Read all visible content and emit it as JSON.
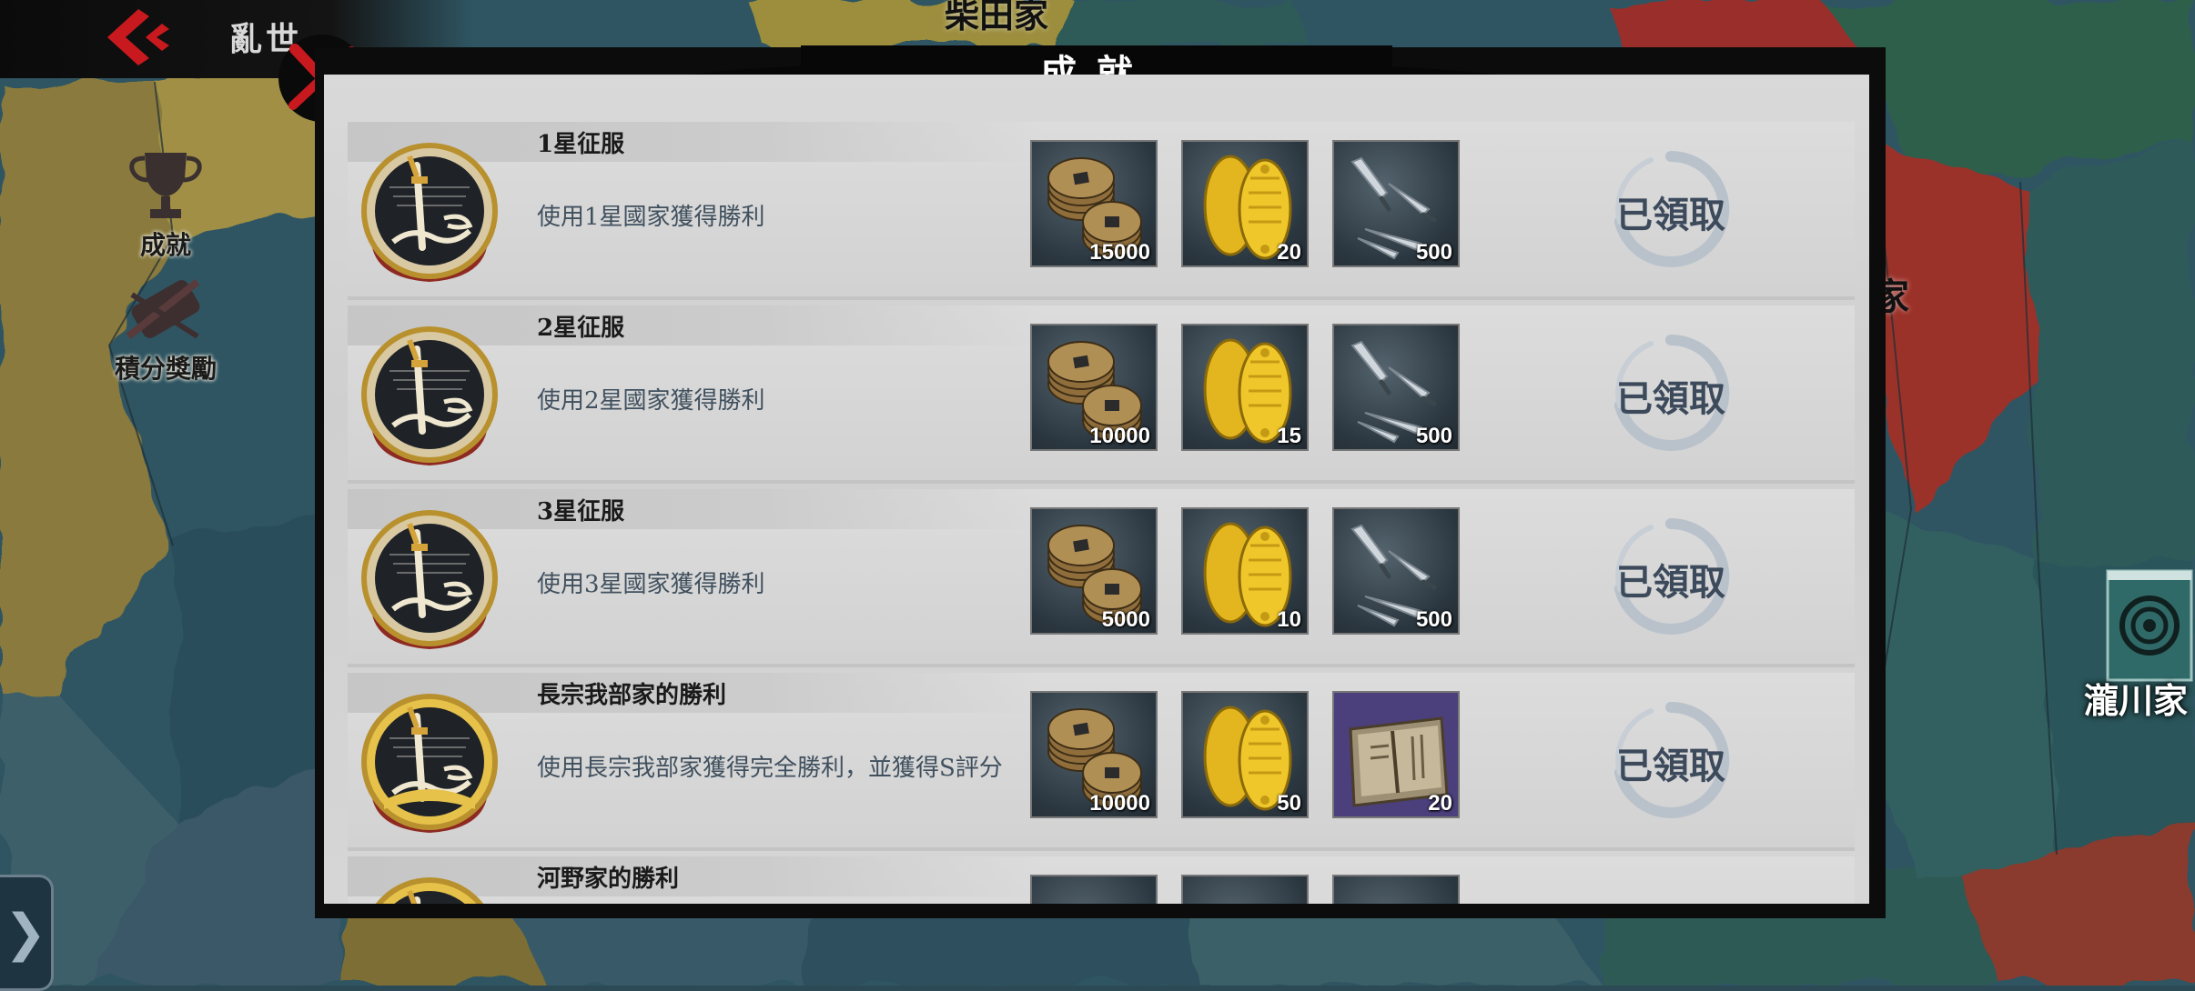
{
  "header": {
    "mode_title": "亂世",
    "panel_title": "成就"
  },
  "side_menu": {
    "achievements_label": "成就",
    "points_reward_label": "積分獎勵"
  },
  "map_labels": {
    "top": "柴田家",
    "right": "家",
    "bottom_right": "瀧川家"
  },
  "icons": {
    "back": "back-arrow-icon",
    "close": "close-x-icon",
    "trophy": "trophy-icon",
    "scroll": "scroll-sword-icon",
    "expand": "chevron-right-icon",
    "coin": "coin-stack-icon",
    "gold": "koban-gold-icon",
    "kunai": "kunai-icon",
    "book": "book-icon"
  },
  "colors": {
    "accent_red": "#c8191e",
    "panel_bg": "#d4d4d4",
    "claimed_text": "#3c4a5c"
  },
  "achievements": [
    {
      "name": "1星征服",
      "description": "使用1星國家獲得勝利",
      "rewards": [
        {
          "item": "coins",
          "qty": "15000"
        },
        {
          "item": "gold",
          "qty": "20"
        },
        {
          "item": "kunai",
          "qty": "500"
        }
      ],
      "status": "已領取"
    },
    {
      "name": "2星征服",
      "description": "使用2星國家獲得勝利",
      "rewards": [
        {
          "item": "coins",
          "qty": "10000"
        },
        {
          "item": "gold",
          "qty": "15"
        },
        {
          "item": "kunai",
          "qty": "500"
        }
      ],
      "status": "已領取"
    },
    {
      "name": "3星征服",
      "description": "使用3星國家獲得勝利",
      "rewards": [
        {
          "item": "coins",
          "qty": "5000"
        },
        {
          "item": "gold",
          "qty": "10"
        },
        {
          "item": "kunai",
          "qty": "500"
        }
      ],
      "status": "已領取"
    },
    {
      "name": "長宗我部家的勝利",
      "description": "使用長宗我部家獲得完全勝利，並獲得S評分",
      "rewards": [
        {
          "item": "coins",
          "qty": "10000"
        },
        {
          "item": "gold",
          "qty": "50"
        },
        {
          "item": "book",
          "qty": "20"
        }
      ],
      "status": "已領取"
    },
    {
      "name": "河野家的勝利",
      "description": "",
      "rewards": [],
      "status": ""
    }
  ]
}
